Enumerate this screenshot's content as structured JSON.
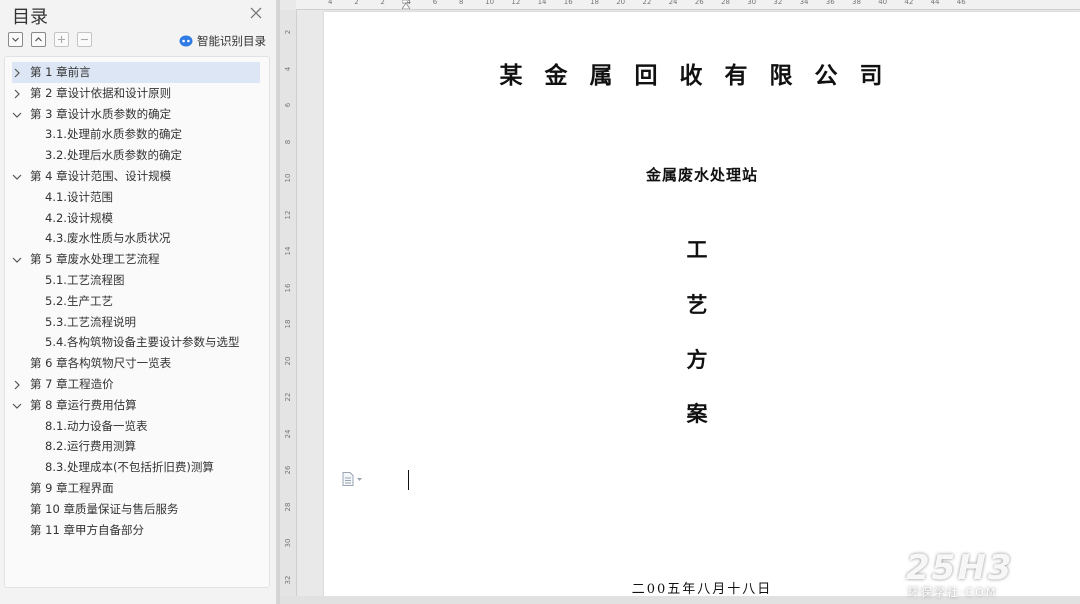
{
  "toc": {
    "title": "目录",
    "smart_button_label": "智能识别目录",
    "items": [
      {
        "label": "第 1 章前言",
        "level": 1,
        "state": "collapsed",
        "selected": true
      },
      {
        "label": "第 2 章设计依据和设计原则",
        "level": 1,
        "state": "collapsed"
      },
      {
        "label": "第 3 章设计水质参数的确定",
        "level": 1,
        "state": "expanded"
      },
      {
        "label": "3.1.处理前水质参数的确定",
        "level": 2
      },
      {
        "label": "3.2.处理后水质参数的确定",
        "level": 2
      },
      {
        "label": "第 4 章设计范围、设计规模",
        "level": 1,
        "state": "expanded"
      },
      {
        "label": "4.1.设计范围",
        "level": 2
      },
      {
        "label": "4.2.设计规模",
        "level": 2
      },
      {
        "label": "4.3.废水性质与水质状况",
        "level": 2
      },
      {
        "label": "第 5 章废水处理工艺流程",
        "level": 1,
        "state": "expanded"
      },
      {
        "label": "5.1.工艺流程图",
        "level": 2
      },
      {
        "label": "5.2.生产工艺",
        "level": 2
      },
      {
        "label": "5.3.工艺流程说明",
        "level": 2
      },
      {
        "label": "5.4.各构筑物设备主要设计参数与选型",
        "level": 2
      },
      {
        "label": "第 6 章各构筑物尺寸一览表",
        "level": 1,
        "state": "none"
      },
      {
        "label": "第 7 章工程造价",
        "level": 1,
        "state": "collapsed"
      },
      {
        "label": "第 8 章运行费用估算",
        "level": 1,
        "state": "expanded"
      },
      {
        "label": "8.1.动力设备一览表",
        "level": 2
      },
      {
        "label": "8.2.运行费用测算",
        "level": 2
      },
      {
        "label": "8.3.处理成本(不包括折旧费)测算",
        "level": 2
      },
      {
        "label": "第 9 章工程界面",
        "level": 1,
        "state": "none"
      },
      {
        "label": "第 10 章质量保证与售后服务",
        "level": 1,
        "state": "none"
      },
      {
        "label": "第 11 章甲方自备部分",
        "level": 1,
        "state": "none"
      }
    ]
  },
  "document": {
    "company": "某金属回收有限公司",
    "station": "金属废水处理站",
    "vertical_title": [
      "工",
      "艺",
      "方",
      "案"
    ],
    "date": "二00五年八月十八日"
  },
  "ruler": {
    "vertical_ticks": [
      "2",
      "4",
      "6",
      "8",
      "10",
      "12",
      "14",
      "16",
      "18",
      "20",
      "22",
      "24",
      "26",
      "28",
      "30",
      "32"
    ],
    "horizontal_ticks": [
      "4",
      "2",
      "2",
      "4",
      "6",
      "8",
      "10",
      "12",
      "14",
      "16",
      "18",
      "20",
      "22",
      "24",
      "26",
      "28",
      "30",
      "32",
      "34",
      "36",
      "38",
      "40",
      "42",
      "44",
      "46"
    ]
  },
  "watermark": {
    "logo": "25H3",
    "subtitle": "环保学社·COM"
  },
  "colors": {
    "selected_row": "#dce6f4",
    "smart_icon": "#2f7be5",
    "panel_bg": "#f3f3f3"
  }
}
